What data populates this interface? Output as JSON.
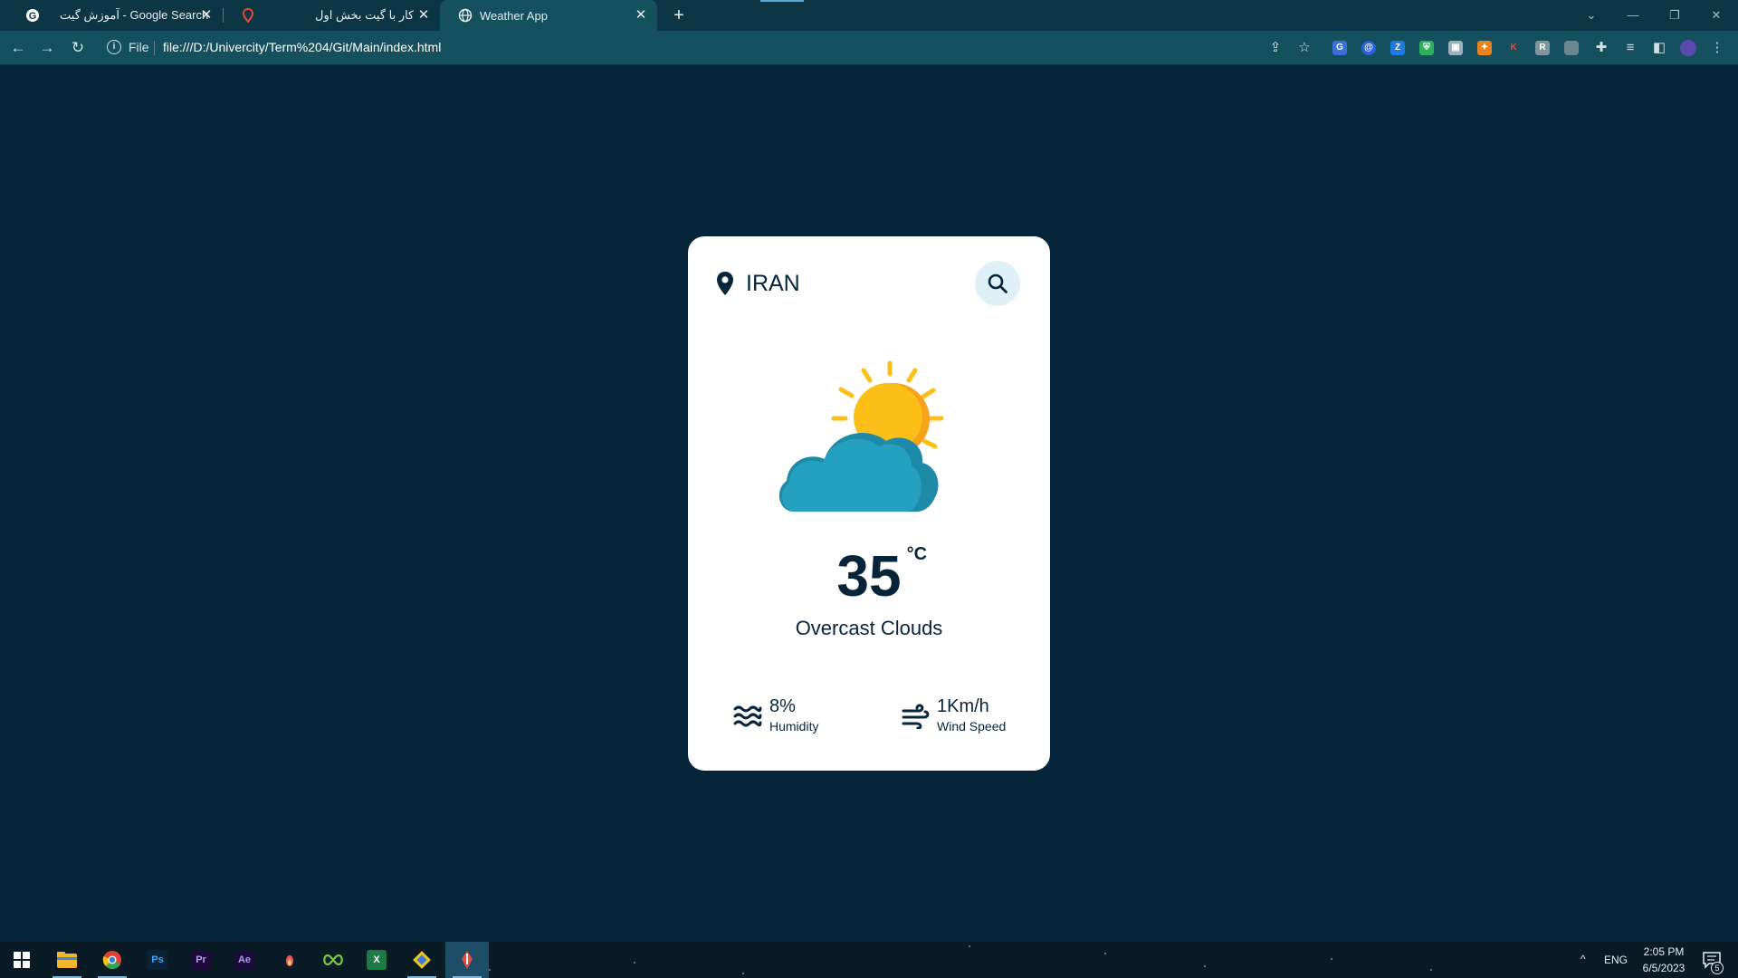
{
  "browser": {
    "tabs": [
      {
        "title": "آموزش گیت - Google Search",
        "favicon": "google-icon"
      },
      {
        "title": "کار با گیت بخش اول",
        "favicon": "red-pin-icon"
      },
      {
        "title": "Weather App",
        "favicon": "globe-icon",
        "active": true
      }
    ],
    "address": {
      "scheme_label": "File",
      "url": "file:///D:/Univercity/Term%204/Git/Main/index.html"
    }
  },
  "weather": {
    "location": "IRAN",
    "search_icon": "search-icon",
    "condition_icon": "sun-behind-cloud-icon",
    "temperature": "35",
    "unit": "°C",
    "description": "Overcast Clouds",
    "humidity": {
      "value": "8%",
      "label": "Humidity"
    },
    "wind": {
      "value": "1Km/h",
      "label": "Wind Speed"
    }
  },
  "taskbar": {
    "language": "ENG",
    "time": "2:05 PM",
    "date": "6/5/2023",
    "notifications": "5",
    "apps": [
      "windows-start",
      "file-explorer",
      "chrome",
      "photoshop",
      "premiere-pro",
      "after-effects",
      "misc-app",
      "infinity-app",
      "excel",
      "git-app",
      "active-app"
    ]
  },
  "colors": {
    "page_bg": "#06243a",
    "card_bg": "#ffffff",
    "text_dark": "#06243a",
    "sun": "#fbbf17",
    "sun_shade": "#f6a21a",
    "cloud": "#25a1bf",
    "cloud_shade": "#1d8ba8"
  }
}
